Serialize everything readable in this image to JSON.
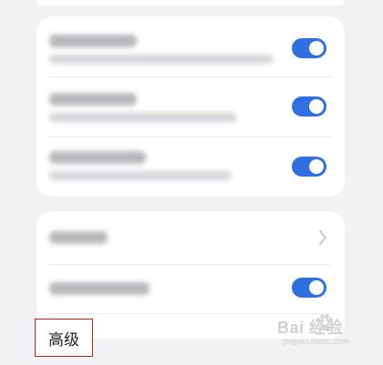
{
  "screen": {
    "background_color": "#f2f2f4",
    "accent_color": "#2f6fe0"
  },
  "settings_group_1": {
    "rows": [
      {
        "title": "",
        "subtitle": "",
        "toggle_on": true
      },
      {
        "title": "",
        "subtitle": "",
        "toggle_on": true
      },
      {
        "title": "",
        "subtitle": "",
        "toggle_on": true
      }
    ]
  },
  "settings_group_2": {
    "rows": [
      {
        "title": "",
        "control": "chevron-right-icon"
      },
      {
        "title": "",
        "control": "toggle",
        "toggle_on": true
      }
    ]
  },
  "advanced_section": {
    "label": "高级",
    "highlight_color": "#d11a1a"
  },
  "watermark": {
    "main": "Bai  经验",
    "sub": "jingyan.baidu.com"
  }
}
